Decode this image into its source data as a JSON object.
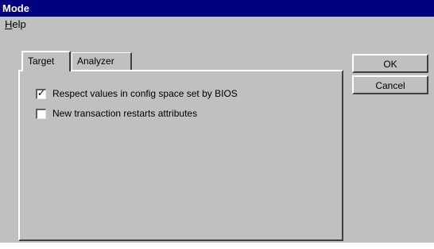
{
  "window": {
    "title": "Mode"
  },
  "menu": {
    "help": {
      "mnemonic": "H",
      "rest": "elp"
    }
  },
  "tabs": [
    {
      "label": "Target",
      "active": true
    },
    {
      "label": "Analyzer",
      "active": false
    }
  ],
  "options": [
    {
      "label": "Respect values in config space set by BIOS",
      "checked": true
    },
    {
      "label": "New transaction restarts attributes",
      "checked": false
    }
  ],
  "buttons": {
    "ok": "OK",
    "cancel": "Cancel"
  },
  "icons": {
    "checkmark": "checkmark-icon"
  }
}
